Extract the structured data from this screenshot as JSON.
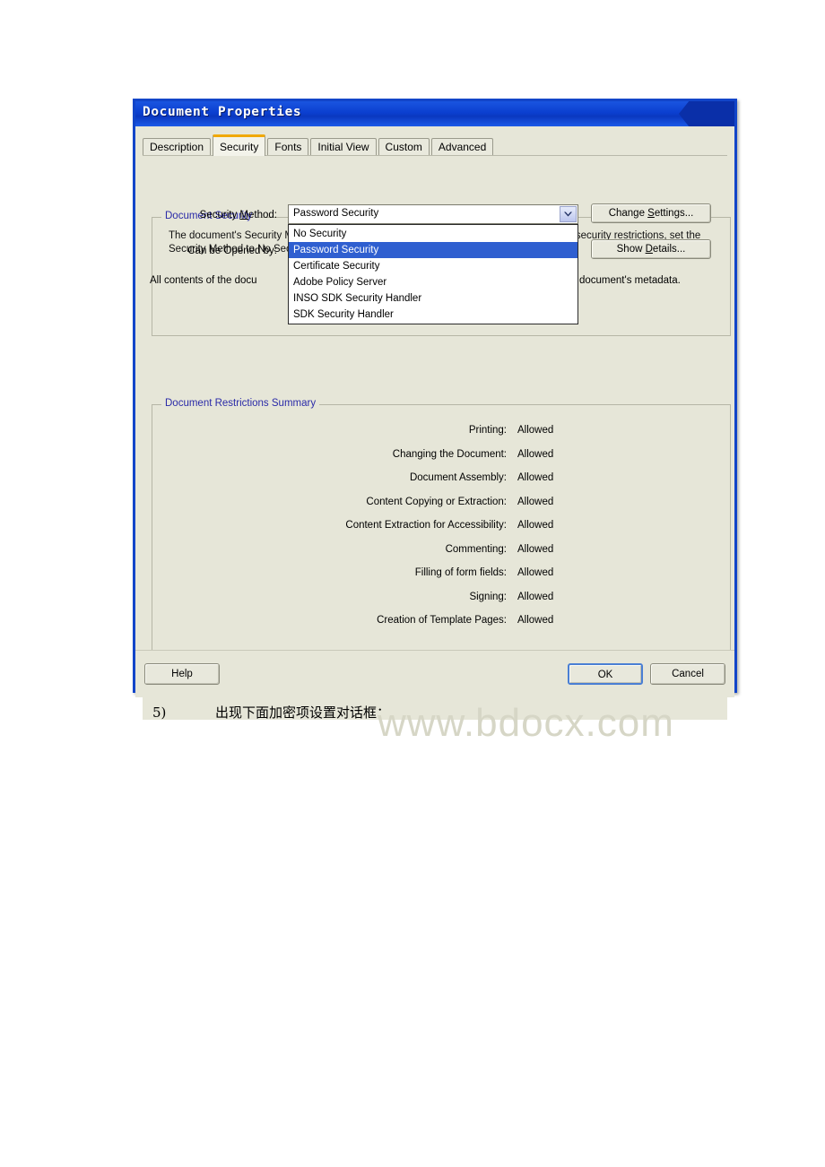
{
  "window": {
    "title": "Document Properties"
  },
  "tabs": [
    {
      "label": "Description",
      "active": false
    },
    {
      "label": "Security",
      "active": true
    },
    {
      "label": "Fonts",
      "active": false
    },
    {
      "label": "Initial View",
      "active": false
    },
    {
      "label": "Custom",
      "active": false
    },
    {
      "label": "Advanced",
      "active": false
    }
  ],
  "document_security": {
    "group_title": "Document Security",
    "description": "The document's Security Method restricts what can be done to the document. To remove security restrictions, set the Security Method to No Security.",
    "security_method_label": "Security Method:",
    "security_method_accel": "M",
    "security_method_value": "Password Security",
    "can_be_opened_by_label": "Can be Opened by:",
    "all_contents_label": "All contents of the docu",
    "all_contents_label_tail": "document's metadata.",
    "change_settings_button": "Change Settings...",
    "change_settings_accel": "S",
    "show_details_button": "Show Details...",
    "show_details_accel": "D"
  },
  "dropdown": {
    "open": true,
    "options": [
      "No Security",
      "Password Security",
      "Certificate Security",
      "Adobe Policy Server",
      "INSO SDK Security Handler",
      "SDK Security Handler"
    ],
    "selected_index": 1,
    "arrow_icon": "chevron-down-icon"
  },
  "restrictions": {
    "group_title": "Document Restrictions Summary",
    "rows": [
      {
        "label": "Printing:",
        "value": "Allowed"
      },
      {
        "label": "Changing the Document:",
        "value": "Allowed"
      },
      {
        "label": "Document Assembly:",
        "value": "Allowed"
      },
      {
        "label": "Content Copying or Extraction:",
        "value": "Allowed"
      },
      {
        "label": "Content Extraction for Accessibility:",
        "value": "Allowed"
      },
      {
        "label": "Commenting:",
        "value": "Allowed"
      },
      {
        "label": "Filling of form fields:",
        "value": "Allowed"
      },
      {
        "label": "Signing:",
        "value": "Allowed"
      },
      {
        "label": "Creation of Template Pages:",
        "value": "Allowed"
      }
    ]
  },
  "footer": {
    "help_button": "Help",
    "ok_button": "OK",
    "cancel_button": "Cancel"
  },
  "watermark": {
    "text": "www.bdocx.com"
  },
  "caption": {
    "number": "5)",
    "text": "出现下面加密项设置对话框："
  },
  "colors": {
    "titlebar_blue": "#0b3fd0",
    "dialog_border": "#1245c9",
    "dialog_bg": "#e6e6d8",
    "group_title": "#2a2aa8",
    "active_tab_accent": "#f0a800",
    "selection_blue": "#2f5fd0",
    "watermark": "#d6d6c6"
  }
}
